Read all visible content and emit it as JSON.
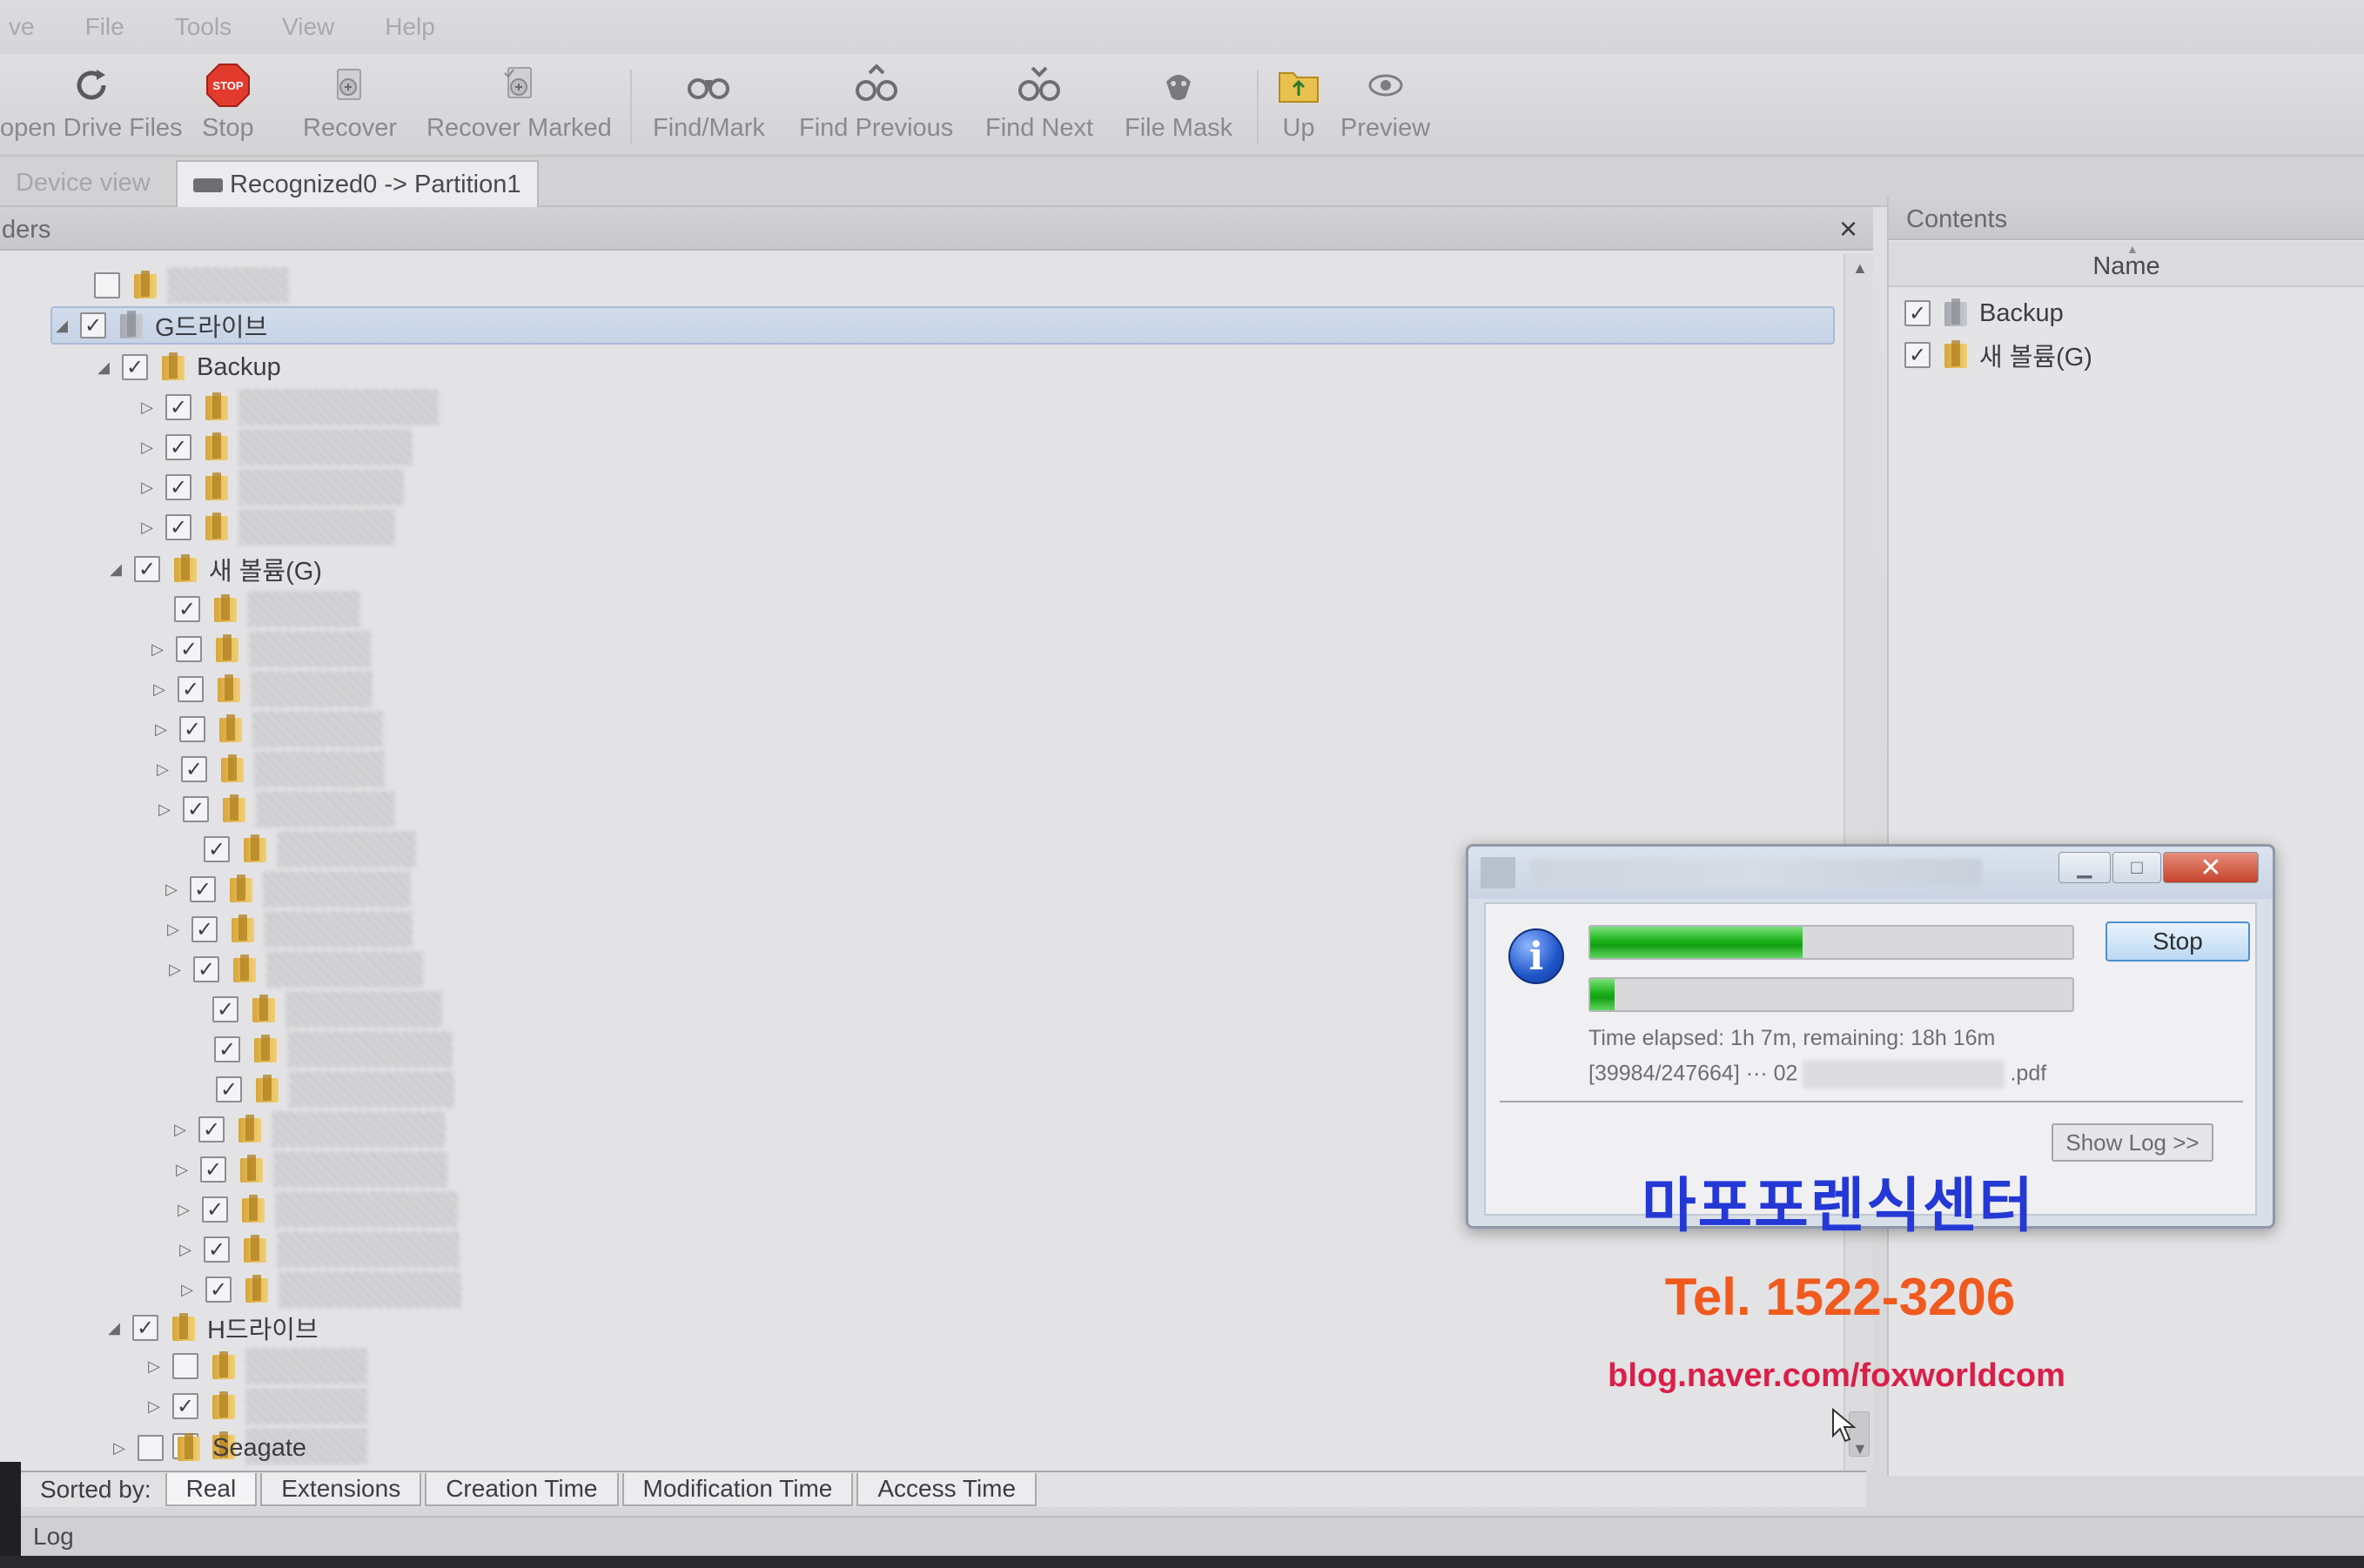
{
  "menu": [
    "ve",
    "File",
    "Tools",
    "View",
    "Help"
  ],
  "toolbar": {
    "buttons": [
      {
        "label": "open Drive Files",
        "icon": "refresh-icon"
      },
      {
        "label": "Stop",
        "icon": "stop-sign-icon"
      },
      {
        "label": "Recover",
        "icon": "recover-icon"
      },
      {
        "label": "Recover Marked",
        "icon": "recover-marked-icon"
      },
      {
        "label": "Find/Mark",
        "icon": "binoculars-icon"
      },
      {
        "label": "Find Previous",
        "icon": "find-previous-icon"
      },
      {
        "label": "Find Next",
        "icon": "find-next-icon"
      },
      {
        "label": "File Mask",
        "icon": "file-mask-icon"
      },
      {
        "label": "Up",
        "icon": "folder-up-icon"
      },
      {
        "label": "Preview",
        "icon": "eye-icon"
      }
    ]
  },
  "tabs": {
    "device_view": "Device view",
    "partition": "Recognized0 -> Partition1"
  },
  "folders_panel": {
    "title": "ders",
    "close": "×",
    "root_g": "G드라이브",
    "backup": "Backup",
    "new_volume": "새 볼륨(G)",
    "root_h": "H드라이브",
    "seagate": "Seagate",
    "check": "✓"
  },
  "contents_panel": {
    "title": "Contents",
    "column": "Name",
    "items": [
      "Backup",
      "새 볼륨(G)"
    ]
  },
  "sortbar": {
    "label": "Sorted by:",
    "options": [
      "Real",
      "Extensions",
      "Creation Time",
      "Modification Time",
      "Access Time"
    ]
  },
  "log_label": "Log",
  "dialog": {
    "stop": "Stop",
    "time_text": "Time elapsed: 1h 7m, remaining: 18h 16m",
    "count_text": "[39984/247664]",
    "file_prefix": "··· 02",
    "file_suffix": ".pdf",
    "show_log": "Show Log >>",
    "progress_main": 0.44,
    "progress_file": 0.05
  },
  "watermark": {
    "name": "마포포렌식센터",
    "tel": "Tel. 1522-3206",
    "blog": "blog.naver.com/foxworldcom"
  }
}
